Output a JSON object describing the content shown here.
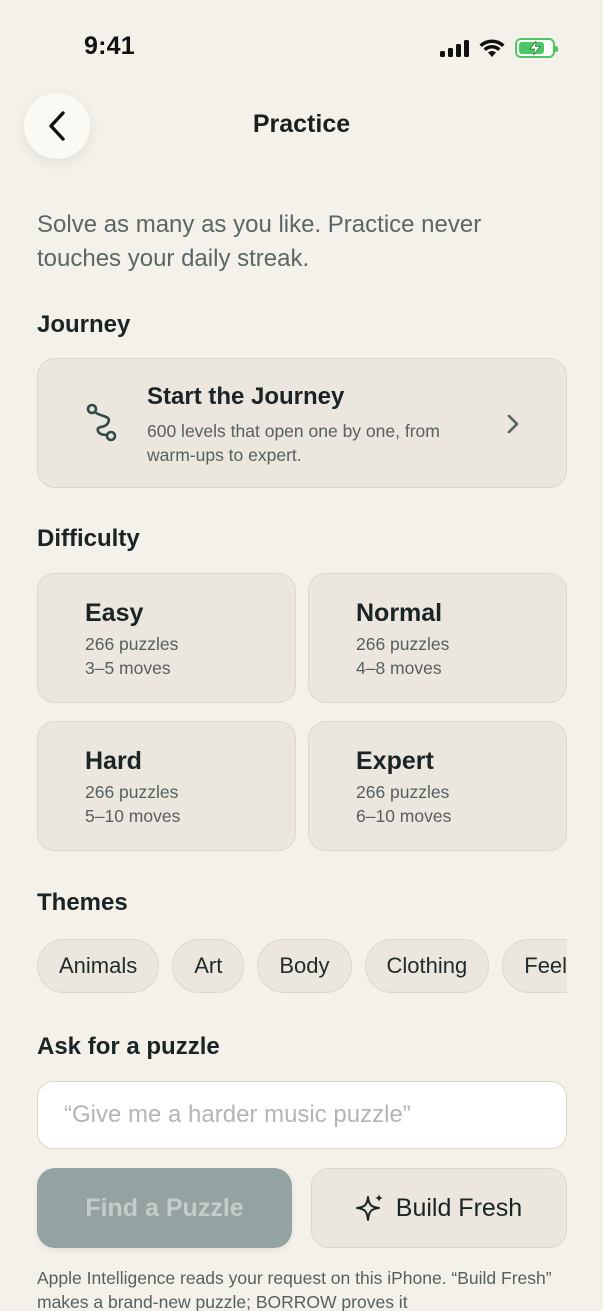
{
  "status_bar": {
    "time": "9:41"
  },
  "header": {
    "title": "Practice"
  },
  "intro": "Solve as many as you like. Practice never touches your daily streak.",
  "journey": {
    "heading": "Journey",
    "title": "Start the Journey",
    "subtitle": "600 levels that open one by one, from warm-ups to expert."
  },
  "difficulty": {
    "heading": "Difficulty",
    "levels": [
      {
        "name": "Easy",
        "puzzles": "266 puzzles",
        "moves": "3–5 moves"
      },
      {
        "name": "Normal",
        "puzzles": "266 puzzles",
        "moves": "4–8 moves"
      },
      {
        "name": "Hard",
        "puzzles": "266 puzzles",
        "moves": "5–10 moves"
      },
      {
        "name": "Expert",
        "puzzles": "266 puzzles",
        "moves": "6–10 moves"
      }
    ]
  },
  "themes": {
    "heading": "Themes",
    "items": [
      "Animals",
      "Art",
      "Body",
      "Clothing",
      "Feelings"
    ]
  },
  "ask": {
    "heading": "Ask for a puzzle",
    "placeholder": "“Give me a harder music puzzle”",
    "find_label": "Find a Puzzle",
    "build_label": "Build Fresh",
    "footnote": "Apple Intelligence reads your request on this iPhone. “Build Fresh” makes a brand-new puzzle; BORROW proves it"
  },
  "colors": {
    "background": "#f4f1ea",
    "card": "#ebe6de",
    "accent": "#2f4a47",
    "disabled_button": "#94a3a1",
    "battery": "#4cc764"
  }
}
